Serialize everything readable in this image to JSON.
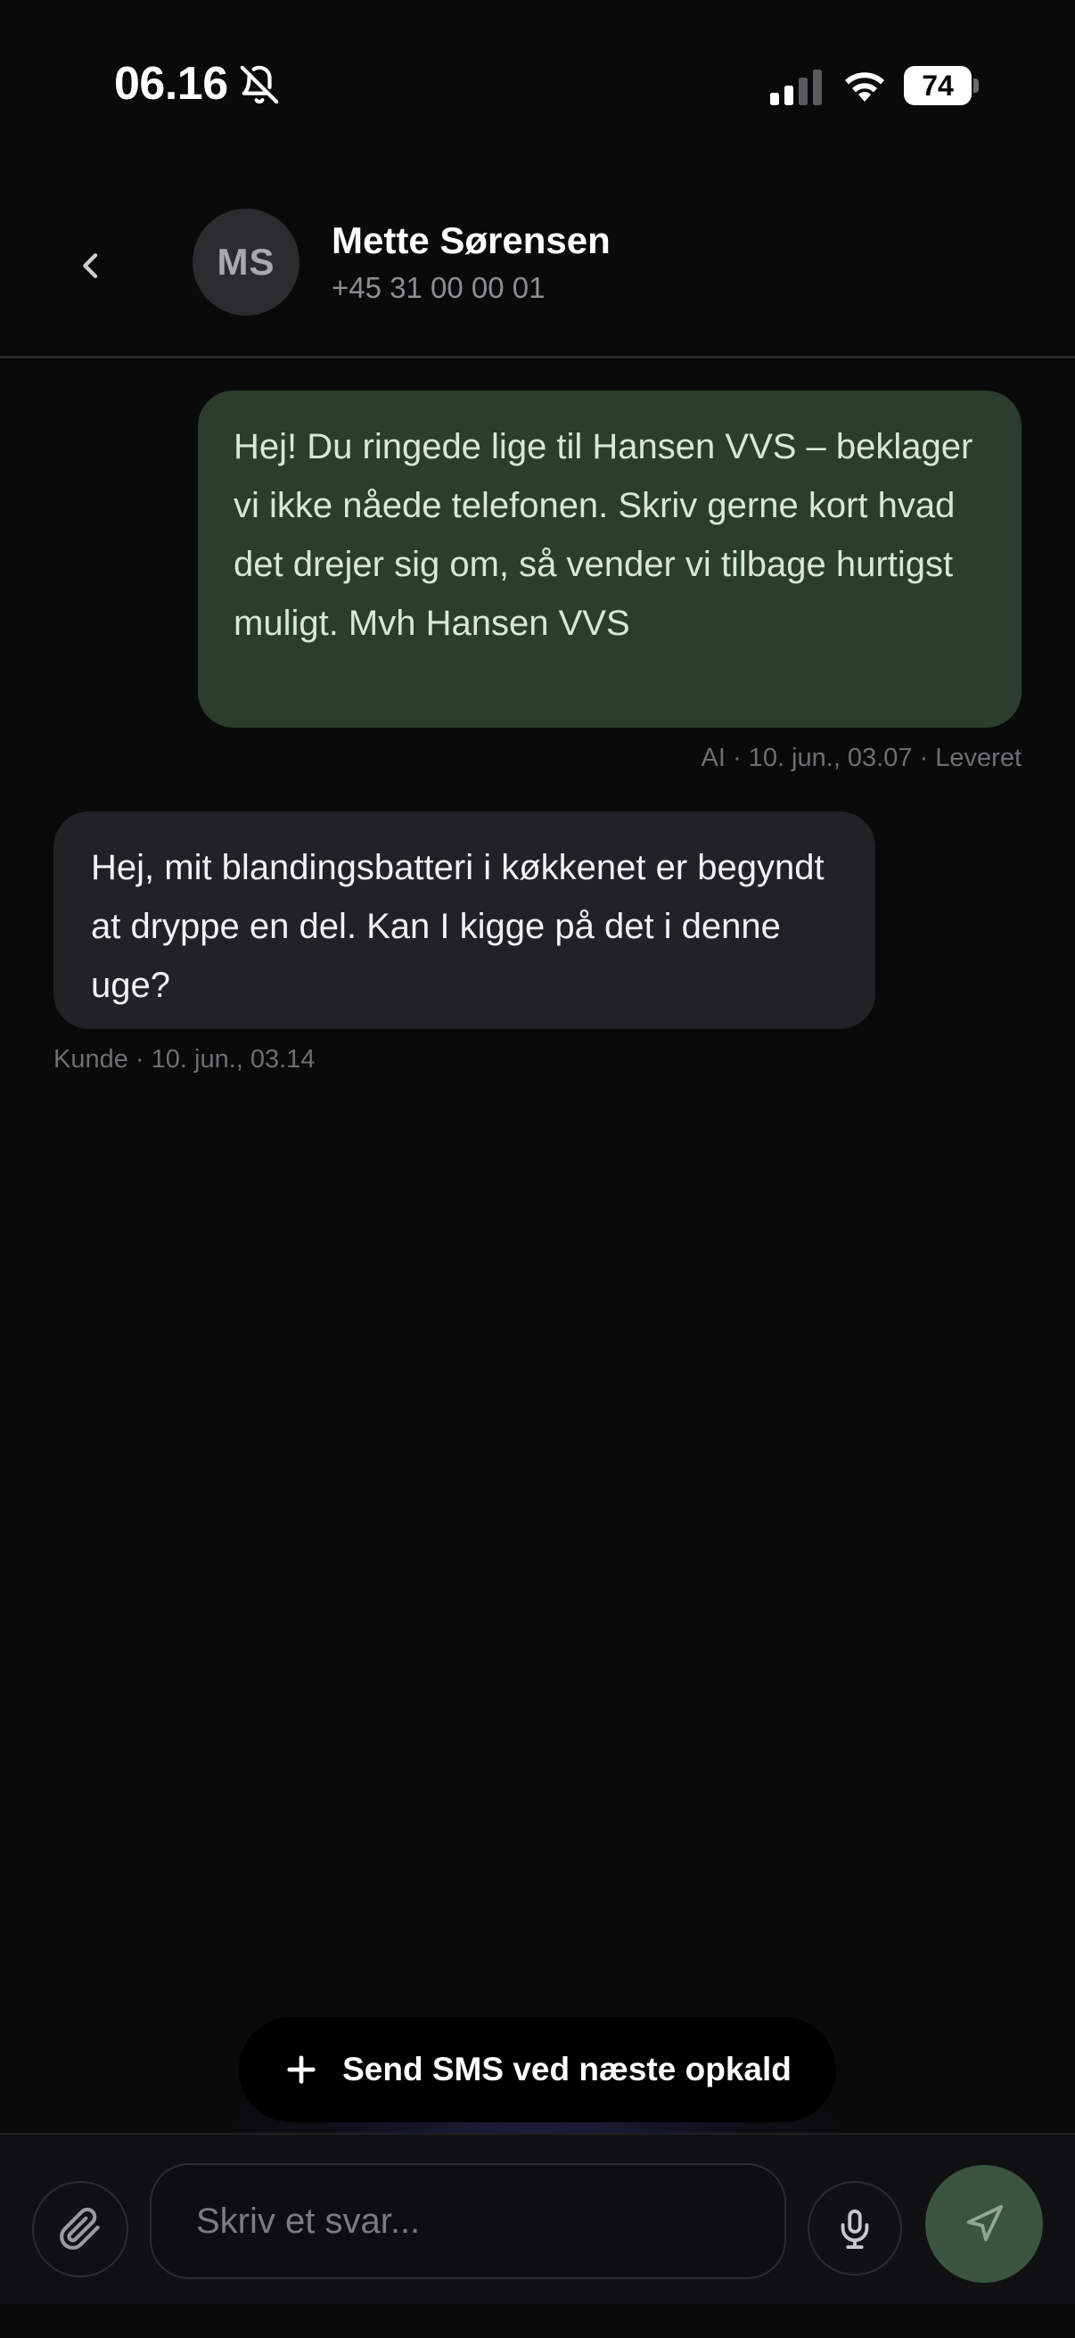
{
  "status_bar": {
    "time": "06.16",
    "battery": "74",
    "icons": [
      "bell-off-icon",
      "signal-icon",
      "wifi-icon",
      "battery-icon"
    ]
  },
  "header": {
    "back_icon": "chevron-left-icon",
    "avatar_initials": "MS",
    "contact_name": "Mette Sørensen",
    "contact_phone": "+45 31 00 00 01"
  },
  "messages": [
    {
      "direction": "outgoing",
      "text": "Hej! Du ringede lige til Hansen VVS – beklager vi ikke nåede telefonen. Skriv gerne kort hvad det drejer sig om, så vender vi tilbage hurtigst muligt. Mvh Hansen VVS",
      "meta": "AI · 10. jun., 03.07 · Leveret"
    },
    {
      "direction": "incoming",
      "text": "Hej, mit blandingsbatteri i køkkenet er begyndt at dryppe en del. Kan I kigge på det i denne uge?",
      "meta": "Kunde · 10. jun., 03.14"
    }
  ],
  "action_pill": {
    "icon": "plus-icon",
    "label": "Send SMS ved næste opkald"
  },
  "composer": {
    "attach_icon": "paperclip-icon",
    "placeholder": "Skriv et svar...",
    "value": "",
    "mic_icon": "microphone-icon",
    "send_icon": "send-icon"
  },
  "colors": {
    "background": "#0a0a0b",
    "outgoing_bubble": "#2b3d2c",
    "incoming_bubble": "#222226",
    "send_button": "#3a553f"
  }
}
